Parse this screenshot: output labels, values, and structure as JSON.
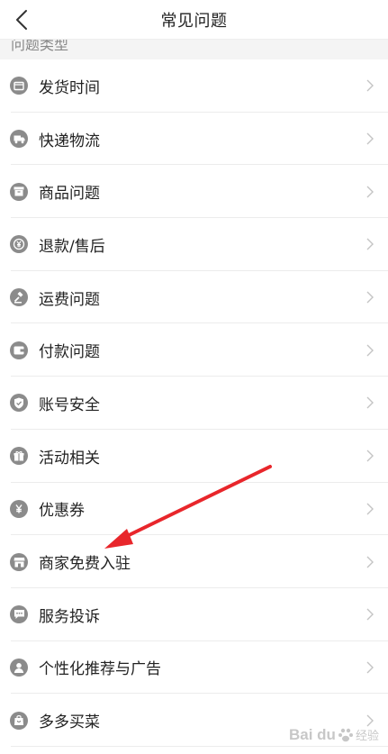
{
  "header": {
    "title": "常见问题",
    "back_icon": "chevron-left-icon"
  },
  "section": {
    "title": "问题类型"
  },
  "items": [
    {
      "label": "发货时间",
      "icon": "calendar-icon"
    },
    {
      "label": "快递物流",
      "icon": "truck-icon"
    },
    {
      "label": "商品问题",
      "icon": "box-icon"
    },
    {
      "label": "退款/售后",
      "icon": "yen-coin-icon"
    },
    {
      "label": "运费问题",
      "icon": "gavel-icon"
    },
    {
      "label": "付款问题",
      "icon": "wallet-icon"
    },
    {
      "label": "账号安全",
      "icon": "shield-icon"
    },
    {
      "label": "活动相关",
      "icon": "gift-icon"
    },
    {
      "label": "优惠券",
      "icon": "coupon-yen-icon"
    },
    {
      "label": "商家免费入驻",
      "icon": "store-icon"
    },
    {
      "label": "服务投诉",
      "icon": "chat-bubble-icon"
    },
    {
      "label": "个性化推荐与广告",
      "icon": "person-icon"
    },
    {
      "label": "多多买菜",
      "icon": "shopping-bag-icon"
    }
  ],
  "colors": {
    "icon": "#8b8b8b",
    "annotation_arrow": "#e8262b",
    "divider": "#ececec"
  },
  "watermark": {
    "brand": "Bai du",
    "text": "经验",
    "icon": "baidu-paw-icon"
  }
}
